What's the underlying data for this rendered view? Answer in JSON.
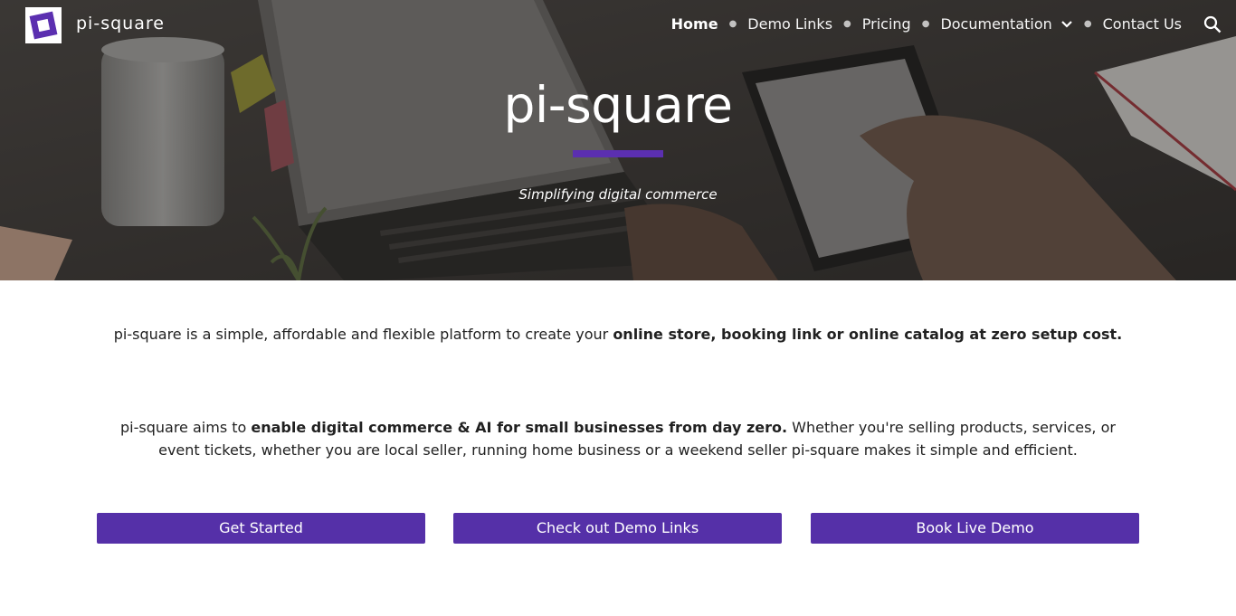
{
  "header": {
    "site_name": "pi-square",
    "nav": [
      {
        "label": "Home",
        "active": true
      },
      {
        "label": "Demo Links"
      },
      {
        "label": "Pricing"
      },
      {
        "label": "Documentation",
        "has_dropdown": true
      },
      {
        "label": "Contact Us"
      }
    ],
    "search_icon": "search-icon"
  },
  "hero": {
    "title": "pi-square",
    "subtitle": "Simplifying digital commerce",
    "accent_color": "#5b2fb0"
  },
  "intro": {
    "text_plain": "pi-square is a simple, affordable and flexible platform to create your ",
    "text_bold": "online store, booking link or online catalog at zero setup cost."
  },
  "mission": {
    "text_plain_1": "pi-square aims to ",
    "text_bold": "enable digital commerce & AI for small businesses from day zero.",
    "text_plain_2": " Whether you're selling products, services, or event tickets, whether you are local seller, running home business or a weekend seller pi-square makes it simple and efficient."
  },
  "buttons": {
    "get_started": "Get Started",
    "demo_links": "Check out Demo Links",
    "book_demo": "Book Live Demo",
    "color": "#5530a8"
  }
}
